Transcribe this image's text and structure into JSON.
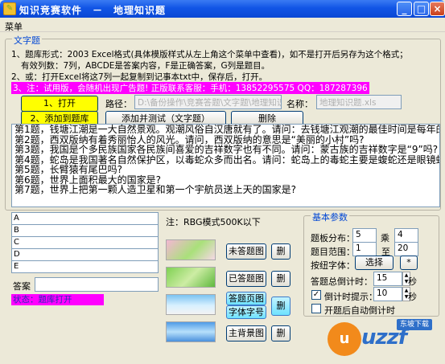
{
  "window": {
    "title": "知识竞赛软件　－　地理知识题"
  },
  "menu": {
    "item": "菜单"
  },
  "text_group": {
    "legend": "文字题",
    "line1": "1、题库形式：2003 Excel格式(具体模版样式从左上角这个菜单中查看)，如不是打开后另存为这个格式；",
    "line2": "有效列数：7列，ABCDE是答案内容，F是正确答案，G列是题目。",
    "line3": "2、或：打开Excel将这7列一起复制到记事本txt中，保存后，打开。",
    "line4": "3、注：试用版，会随机出现广告题! 正版联系客服：手机：13852295575  QQ：187287396"
  },
  "actions": {
    "open_label": "1、打开",
    "add_label": "2、添加到题库",
    "add_test_label": "添加并测试（文字题）",
    "delete_label": "删除",
    "path_label": "路径：",
    "path_value": "D:\\备份操作\\竞赛答题\\文字题\\地理知识题.xls",
    "name_label": "名称：",
    "name_value": "地理知识题.xls"
  },
  "questions": [
    "第1题，钱塘江潮是一大自然景观。观潮风俗自汉唐就有了。请问：去钱塘江观潮的最佳时间是每年的",
    "第2题，西双版纳有着秀丽怡人的风光。请问，西双版纳的意思是“美丽的小村”吗?",
    "第3题，我国是个多民族国家各民族间喜爱的吉祥数字也有不同。请问：蒙古族的吉祥数字是“9”吗?",
    "第4题，蛇岛是我国著名自然保护区，以毒蛇众多而出名。请问：蛇岛上的毒蛇主要是蝮蛇还是眼镜蛇?",
    "第5题，长臂猿有尾巴吗?",
    "第6题，世界上面积最大的国家是?",
    "第7题，世界上把第一颗人造卫星和第一个宇航员送上天的国家是?"
  ],
  "options": [
    "A",
    "B",
    "C",
    "D",
    "E"
  ],
  "answer": {
    "label": "答案",
    "value": ""
  },
  "status": {
    "text": "状态：题库打开"
  },
  "images": {
    "note": "注：RBG模式500K以下",
    "unanswered": "未答题图",
    "answered": "已答题图",
    "answer_page": "答题页图",
    "font_size": "字体字号",
    "main_bg": "主背景图",
    "delete": "删"
  },
  "basic_params": {
    "legend": "基本参数",
    "layout_label": "题板分布：",
    "layout_rows": "5",
    "times_label": "乘",
    "layout_cols": "4",
    "range_label": "题目范围：",
    "range_from": "1",
    "range_to_label": "至",
    "range_to": "20",
    "font_label": "按纽字体：",
    "select_label": "选择",
    "star_label": "*",
    "countdown_label": "答题总倒计时：",
    "countdown_value": "15",
    "sec_label": "秒",
    "countdown_hint_label": "倒计时提示：",
    "countdown_hint_value": "10",
    "countdown_hint_checked": true,
    "auto_start_label": "开题后自动倒计时",
    "auto_start_checked": false
  },
  "watermark": {
    "brand": "uzzf",
    "suffix": ".com",
    "badge": "东坡下载"
  }
}
